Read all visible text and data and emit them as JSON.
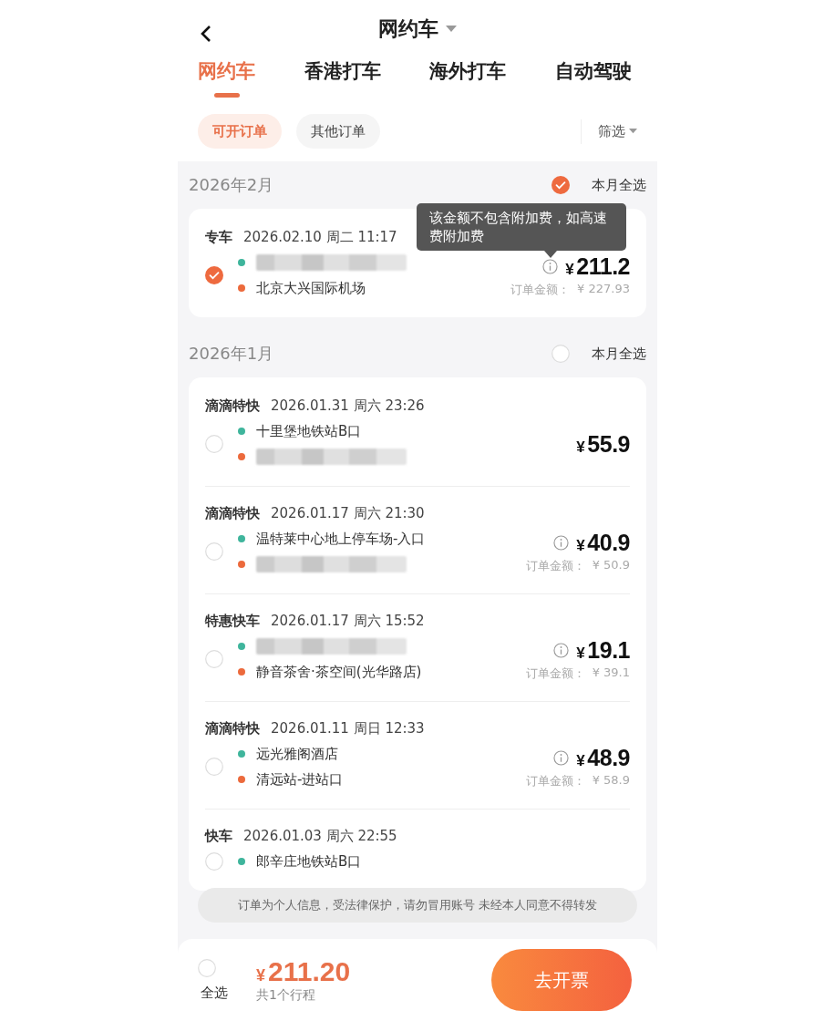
{
  "header": {
    "title": "网约车"
  },
  "tabs": [
    {
      "label": "网约车",
      "selected": true
    },
    {
      "label": "香港打车",
      "selected": false
    },
    {
      "label": "海外打车",
      "selected": false
    },
    {
      "label": "自动驾驶",
      "selected": false
    }
  ],
  "chips": [
    {
      "label": "可开订单",
      "selected": true
    },
    {
      "label": "其他订单",
      "selected": false
    }
  ],
  "filter": {
    "label": "筛选"
  },
  "months": [
    {
      "title": "2026年2月",
      "select_label": "本月全选",
      "all_selected": true,
      "orders": [
        {
          "type": "专车",
          "datetime": "2026.02.10 周二 11:17",
          "selected": true,
          "stops": [
            {
              "kind": "pickup",
              "redacted": true
            },
            {
              "kind": "dropoff",
              "text": "北京大兴国际机场"
            }
          ],
          "info": true,
          "currency": "¥",
          "price": "211.2",
          "amount_label": "订单金额：",
          "amount": "¥ 227.93",
          "tooltip": "该金额不包含附加费，如高速费附加费"
        }
      ]
    },
    {
      "title": "2026年1月",
      "select_label": "本月全选",
      "all_selected": false,
      "orders": [
        {
          "type": "滴滴特快",
          "datetime": "2026.01.31 周六 23:26",
          "selected": false,
          "stops": [
            {
              "kind": "pickup",
              "text": "十里堡地铁站B口"
            },
            {
              "kind": "dropoff",
              "redacted": true
            }
          ],
          "info": false,
          "currency": "¥",
          "price": "55.9"
        },
        {
          "type": "滴滴特快",
          "datetime": "2026.01.17 周六 21:30",
          "selected": false,
          "stops": [
            {
              "kind": "pickup",
              "text": "温特莱中心地上停车场-入口"
            },
            {
              "kind": "dropoff",
              "redacted": true
            }
          ],
          "info": true,
          "currency": "¥",
          "price": "40.9",
          "amount_label": "订单金额：",
          "amount": "¥ 50.9"
        },
        {
          "type": "特惠快车",
          "datetime": "2026.01.17 周六 15:52",
          "selected": false,
          "stops": [
            {
              "kind": "pickup",
              "redacted": true
            },
            {
              "kind": "dropoff",
              "text": "静音茶舍·茶空间(光华路店)"
            }
          ],
          "info": true,
          "currency": "¥",
          "price": "19.1",
          "amount_label": "订单金额：",
          "amount": "¥ 39.1"
        },
        {
          "type": "滴滴特快",
          "datetime": "2026.01.11 周日 12:33",
          "selected": false,
          "stops": [
            {
              "kind": "pickup",
              "text": "远光雅阁酒店"
            },
            {
              "kind": "dropoff",
              "text": "清远站-进站口"
            }
          ],
          "info": true,
          "currency": "¥",
          "price": "48.9",
          "amount_label": "订单金额：",
          "amount": "¥ 58.9"
        },
        {
          "type": "快车",
          "datetime": "2026.01.03 周六 22:55",
          "selected": false,
          "stops": [
            {
              "kind": "pickup",
              "text": "郎辛庄地铁站B口"
            }
          ]
        }
      ]
    }
  ],
  "notice": "订单为个人信息，受法律保护，请勿冒用账号 未经本人同意不得转发",
  "footer": {
    "select_all_checked": false,
    "select_all_label": "全选",
    "currency": "¥",
    "total": "211.20",
    "count": "共1个行程",
    "button": "去开票"
  }
}
